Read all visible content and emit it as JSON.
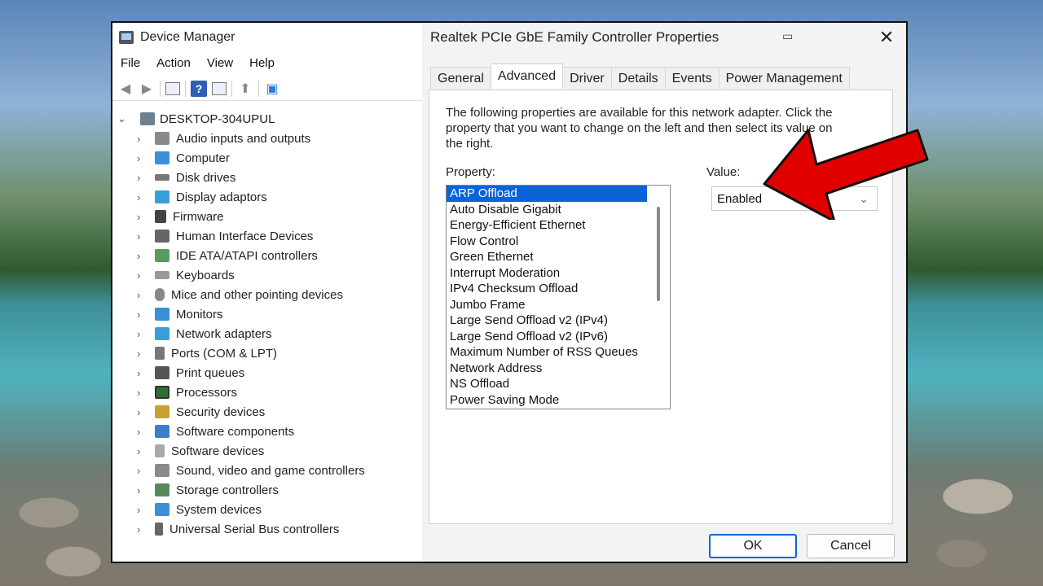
{
  "device_manager": {
    "title": "Device Manager",
    "menu": [
      "File",
      "Action",
      "View",
      "Help"
    ],
    "root": "DESKTOP-304UPUL",
    "categories": [
      "Audio inputs and outputs",
      "Computer",
      "Disk drives",
      "Display adaptors",
      "Firmware",
      "Human Interface Devices",
      "IDE ATA/ATAPI controllers",
      "Keyboards",
      "Mice and other pointing devices",
      "Monitors",
      "Network adapters",
      "Ports (COM & LPT)",
      "Print queues",
      "Processors",
      "Security devices",
      "Software components",
      "Software devices",
      "Sound, video and game controllers",
      "Storage controllers",
      "System devices",
      "Universal Serial Bus controllers"
    ]
  },
  "dialog": {
    "title": "Realtek PCIe GbE Family Controller Properties",
    "tabs": [
      "General",
      "Advanced",
      "Driver",
      "Details",
      "Events",
      "Power Management"
    ],
    "active_tab": "Advanced",
    "description": "The following properties are available for this network adapter. Click the property that you want to change on the left and then select its value on the right.",
    "property_label": "Property:",
    "value_label": "Value:",
    "properties": [
      "ARP Offload",
      "Auto Disable Gigabit",
      "Energy-Efficient Ethernet",
      "Flow Control",
      "Green Ethernet",
      "Interrupt Moderation",
      "IPv4 Checksum Offload",
      "Jumbo Frame",
      "Large Send Offload v2 (IPv4)",
      "Large Send Offload v2 (IPv6)",
      "Maximum Number of RSS Queues",
      "Network Address",
      "NS Offload",
      "Power Saving Mode"
    ],
    "selected_property": "ARP Offload",
    "value": "Enabled",
    "ok_label": "OK",
    "cancel_label": "Cancel"
  },
  "colors": {
    "selection": "#0a64d8",
    "arrow": "#e00000"
  }
}
